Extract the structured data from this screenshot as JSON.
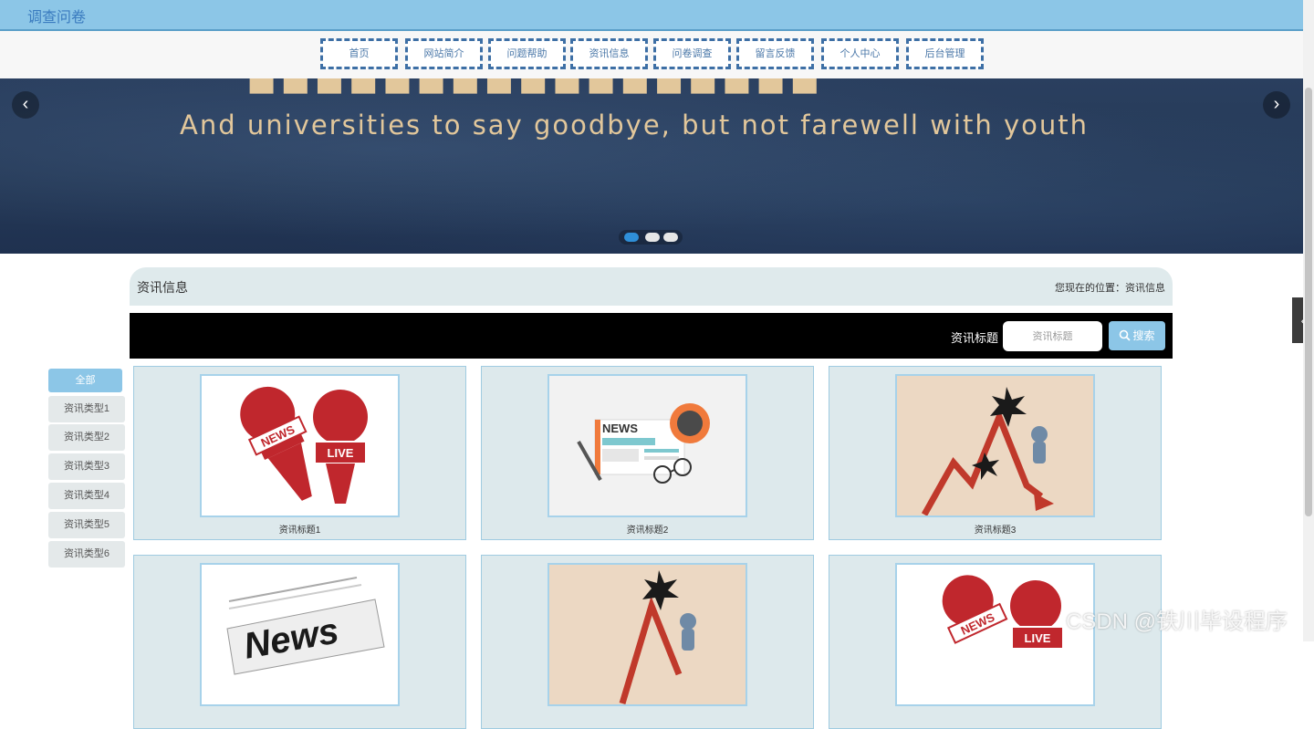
{
  "header": {
    "title": "调查问卷"
  },
  "nav": {
    "items": [
      {
        "label": "首页"
      },
      {
        "label": "网站简介"
      },
      {
        "label": "问题帮助"
      },
      {
        "label": "资讯信息"
      },
      {
        "label": "问卷调查"
      },
      {
        "label": "留言反馈"
      },
      {
        "label": "个人中心"
      },
      {
        "label": "后台管理"
      }
    ]
  },
  "banner": {
    "slogan": "And universities to say goodbye, but not farewell with youth",
    "prev_icon": "chevron-left-icon",
    "next_icon": "chevron-right-icon",
    "slide_count": 3,
    "active_slide": 1
  },
  "section": {
    "title": "资讯信息",
    "location_label": "您现在的位置：",
    "location_value": "资讯信息"
  },
  "search": {
    "label": "资讯标题",
    "placeholder": "资讯标题",
    "button_label": "搜索",
    "button_icon": "search-icon"
  },
  "categories": [
    {
      "label": "全部",
      "active": true
    },
    {
      "label": "资讯类型1"
    },
    {
      "label": "资讯类型2"
    },
    {
      "label": "资讯类型3"
    },
    {
      "label": "资讯类型4"
    },
    {
      "label": "资讯类型5"
    },
    {
      "label": "资讯类型6"
    }
  ],
  "news": [
    {
      "title": "资讯标题1",
      "image": "news-microphones"
    },
    {
      "title": "资讯标题2",
      "image": "newspaper-coffee"
    },
    {
      "title": "资讯标题3",
      "image": "market-crash"
    },
    {
      "title": "",
      "image": "news-paper"
    },
    {
      "title": "",
      "image": "market-crash"
    },
    {
      "title": "",
      "image": "news-microphones"
    }
  ],
  "watermark": "CSDN @铁川毕设程序",
  "colors": {
    "topbar": "#8cc6e7",
    "nav_border": "#3d6fa5",
    "accent": "#8cc6e7",
    "card_bg": "#dde9ec",
    "search_bar": "#000000",
    "banner_text": "#e2c79b"
  }
}
